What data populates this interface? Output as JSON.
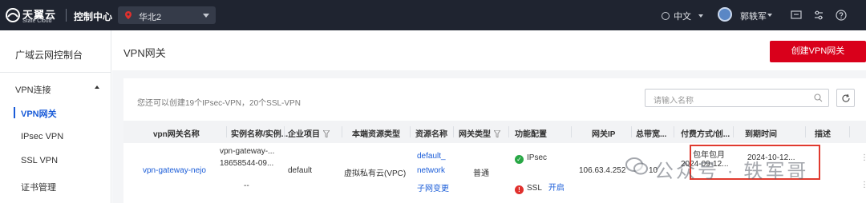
{
  "topbar": {
    "brand_cn": "天翼云",
    "brand_en": "State Cloud",
    "console_title": "控制中心",
    "region": "华北2",
    "language": "中文",
    "username": "郭轶军"
  },
  "sidebar": {
    "title": "广域云网控制台",
    "group": "VPN连接",
    "items": [
      {
        "label": "VPN网关",
        "active": true
      },
      {
        "label": "IPsec VPN",
        "active": false
      },
      {
        "label": "SSL VPN",
        "active": false
      },
      {
        "label": "证书管理",
        "active": false
      }
    ]
  },
  "page": {
    "title": "VPN网关",
    "create_button": "创建VPN网关",
    "quota_text": "您还可以创建19个IPsec-VPN，20个SSL-VPN",
    "search_placeholder": "请输入名称"
  },
  "table": {
    "columns": [
      "vpn网关名称",
      "实例名称/实例...",
      "企业项目",
      "本端资源类型",
      "资源名称",
      "网关类型",
      "功能配置",
      "网关IP",
      "总带宽...",
      "付费方式/创...",
      "到期时间",
      "描述"
    ],
    "row": {
      "name": "vpn-gateway-nejo",
      "instance_line1": "vpn-gateway-...",
      "instance_line2": "18658544-09...",
      "instance_line3": "--",
      "project": "default",
      "resource_type": "虚拟私有云(VPC)",
      "resource_line1": "default_",
      "resource_line2": "network",
      "resource_line3": "子网变更",
      "gateway_type": "普通",
      "feature_ipsec": "IPsec",
      "feature_ssl": "SSL",
      "feature_ssl_action": "开启",
      "gateway_ip": "106.63.4.252",
      "bandwidth": "10",
      "billing": "包年包月",
      "created": "2024-09-12...",
      "expiry": "2024-10-12..."
    }
  },
  "watermark": "公众号 · 轶军哥",
  "colors": {
    "topbar": "#1f2430",
    "accent_red": "#d9001b",
    "link_blue": "#1a5cd8",
    "ok_green": "#28a745",
    "error_red": "#e0302d"
  }
}
